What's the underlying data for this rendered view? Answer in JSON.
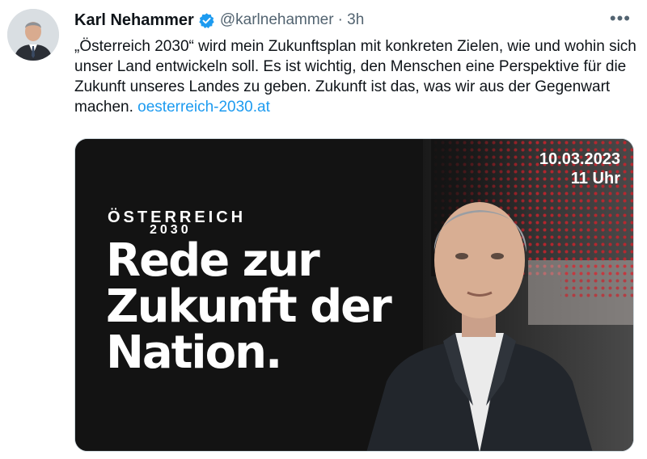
{
  "author": {
    "name": "Karl Nehammer",
    "handle": "@karlnehammer",
    "time": "· 3h"
  },
  "tweet": {
    "text": "„Österreich 2030“ wird mein Zukunftsplan mit konkreten Zielen, wie und wohin sich unser Land entwickeln soll. Es ist wichtig, den Menschen eine Perspektive für die Zukunft unseres Landes zu geben. Zukunft ist das, was wir aus der Gegenwart machen.",
    "link": "oesterreich-2030.at"
  },
  "more_label": "•••",
  "media": {
    "brand_line1": "ÖSTERREICH",
    "brand_line2": "2030",
    "headline": [
      "Rede zur",
      "Zukunft der",
      "Nation."
    ],
    "date": "10.03.2023",
    "time": "11 Uhr"
  },
  "colors": {
    "link": "#1d9bf0",
    "verified": "#1d9bf0",
    "media_bg": "#131313",
    "accent_red": "#d3202a"
  },
  "icons": {
    "verified": "verified-badge-icon",
    "more": "more-dots-icon"
  }
}
